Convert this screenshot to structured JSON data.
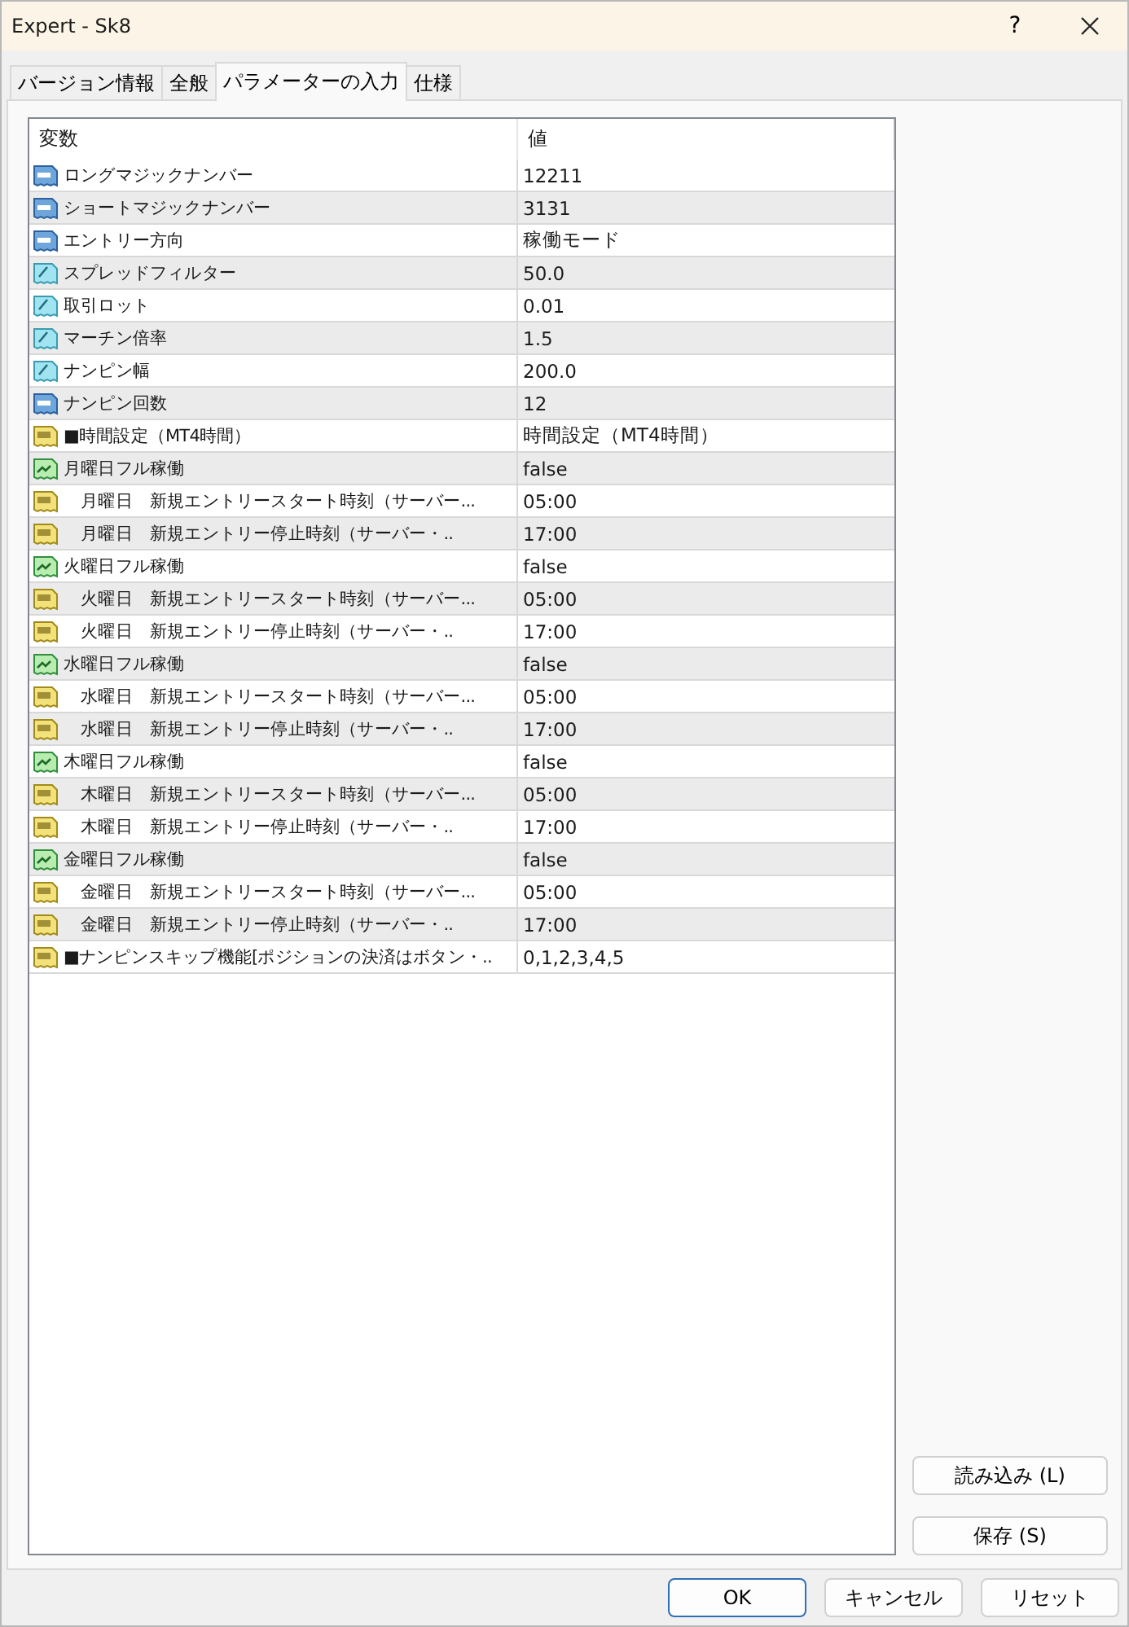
{
  "window": {
    "title": "Expert - Sk8",
    "help": "?"
  },
  "tabs": [
    {
      "label": "バージョン情報",
      "selected": false
    },
    {
      "label": "全般",
      "selected": false
    },
    {
      "label": "パラメーターの入力",
      "selected": true
    },
    {
      "label": "仕様",
      "selected": false
    }
  ],
  "table": {
    "columns": [
      "変数",
      "値"
    ],
    "rows": [
      {
        "kind": "int",
        "name": "ロングマジックナンバー",
        "value": "12211"
      },
      {
        "kind": "int",
        "name": "ショートマジックナンバー",
        "value": "3131"
      },
      {
        "kind": "int",
        "name": "エントリー方向",
        "value": "稼働モード"
      },
      {
        "kind": "double",
        "name": "スプレッドフィルター",
        "value": "50.0"
      },
      {
        "kind": "double",
        "name": "取引ロット",
        "value": "0.01"
      },
      {
        "kind": "double",
        "name": "マーチン倍率",
        "value": "1.5"
      },
      {
        "kind": "double",
        "name": "ナンピン幅",
        "value": "200.0"
      },
      {
        "kind": "int",
        "name": "ナンピン回数",
        "value": "12"
      },
      {
        "kind": "string",
        "name": "■時間設定（MT4時間）",
        "value": "時間設定（MT4時間）"
      },
      {
        "kind": "bool",
        "name": "月曜日フル稼働",
        "value": "false"
      },
      {
        "kind": "string",
        "name": "　月曜日　新規エントリースタート時刻（サーバー...",
        "value": "05:00"
      },
      {
        "kind": "string",
        "name": "　月曜日　新規エントリー停止時刻（サーバー・..",
        "value": "17:00"
      },
      {
        "kind": "bool",
        "name": "火曜日フル稼働",
        "value": "false"
      },
      {
        "kind": "string",
        "name": "　火曜日　新規エントリースタート時刻（サーバー...",
        "value": "05:00"
      },
      {
        "kind": "string",
        "name": "　火曜日　新規エントリー停止時刻（サーバー・..",
        "value": "17:00"
      },
      {
        "kind": "bool",
        "name": "水曜日フル稼働",
        "value": "false"
      },
      {
        "kind": "string",
        "name": "　水曜日　新規エントリースタート時刻（サーバー...",
        "value": "05:00"
      },
      {
        "kind": "string",
        "name": "　水曜日　新規エントリー停止時刻（サーバー・..",
        "value": "17:00"
      },
      {
        "kind": "bool",
        "name": "木曜日フル稼働",
        "value": "false"
      },
      {
        "kind": "string",
        "name": "　木曜日　新規エントリースタート時刻（サーバー...",
        "value": "05:00"
      },
      {
        "kind": "string",
        "name": "　木曜日　新規エントリー停止時刻（サーバー・..",
        "value": "17:00"
      },
      {
        "kind": "bool",
        "name": "金曜日フル稼働",
        "value": "false"
      },
      {
        "kind": "string",
        "name": "　金曜日　新規エントリースタート時刻（サーバー...",
        "value": "05:00"
      },
      {
        "kind": "string",
        "name": "　金曜日　新規エントリー停止時刻（サーバー・..",
        "value": "17:00"
      },
      {
        "kind": "string",
        "name": "■ナンピンスキップ機能[ポジションの決済はボタン・..",
        "value": "0,1,2,3,4,5"
      }
    ]
  },
  "side_buttons": [
    "読み込み (L)",
    "保存 (S)"
  ],
  "buttons": [
    {
      "label": "OK",
      "default": true
    },
    {
      "label": "キャンセル",
      "default": false
    },
    {
      "label": "リセット",
      "default": false
    }
  ]
}
